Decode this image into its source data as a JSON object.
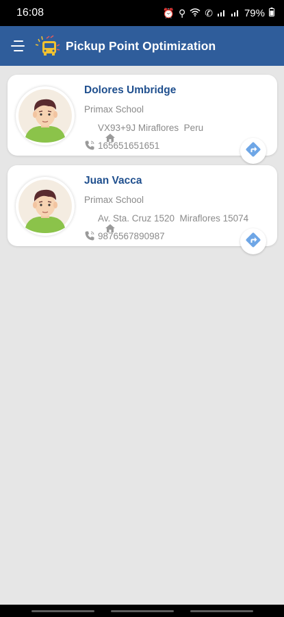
{
  "status_bar": {
    "time": "16:08",
    "battery": "79%"
  },
  "app_bar": {
    "title": "Pickup Point Optimization"
  },
  "students": [
    {
      "name": "Dolores Umbridge",
      "school": "Primax School",
      "address": "VX93+9J Miraflores  Peru",
      "phone": "165651651651"
    },
    {
      "name": "Juan Vacca",
      "school": "Primax School",
      "address": "Av. Sta. Cruz 1520  Miraflores 15074",
      "phone": "9876567890987"
    }
  ],
  "colors": {
    "app_bar": "#2f5d9b",
    "name_text": "#1f4f8e",
    "direction_icon": "#6ea6e6"
  }
}
